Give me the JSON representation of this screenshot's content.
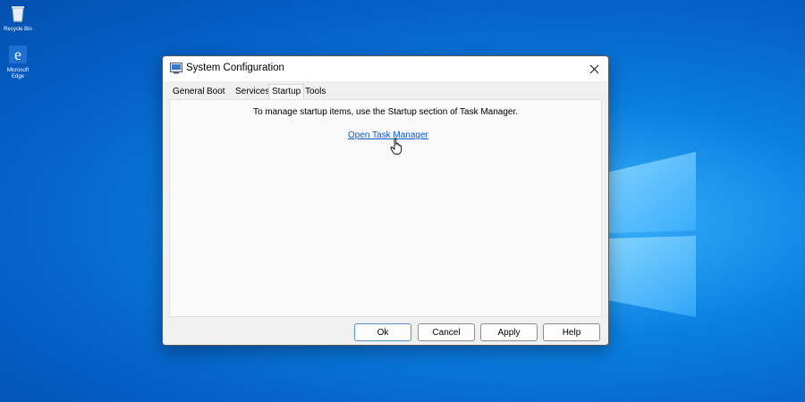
{
  "desktop": {
    "icons": [
      {
        "label": "Recycle Bin",
        "icon": "recycle-bin-icon"
      },
      {
        "label": "Microsoft Edge",
        "icon": "edge-icon"
      }
    ]
  },
  "dialog": {
    "title": "System Configuration",
    "title_icon": "system-config-icon",
    "close_icon": "close-icon",
    "tabs": [
      "General",
      "Boot",
      "Services",
      "Startup",
      "Tools"
    ],
    "active_tab": "Startup",
    "startup": {
      "message": "To manage startup items, use the Startup section of Task Manager.",
      "link_label": "Open Task Manager"
    },
    "buttons": {
      "ok": "Ok",
      "cancel": "Cancel",
      "apply": "Apply",
      "help": "Help"
    }
  },
  "colors": {
    "desktop_blue": "#0a7fe0",
    "link_blue": "#0a56c2",
    "dialog_bg": "#f0f0f0"
  }
}
